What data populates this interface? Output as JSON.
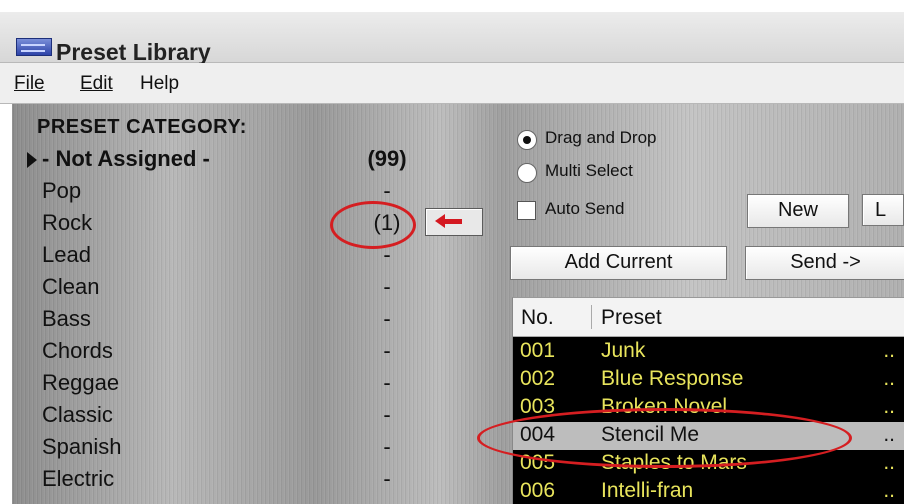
{
  "window": {
    "title": "Preset Library"
  },
  "menu": {
    "file": "File",
    "edit": "Edit",
    "help": "Help"
  },
  "category_panel": {
    "title": "PRESET CATEGORY:",
    "items": [
      {
        "label": "- Not Assigned -",
        "count": "(99)"
      },
      {
        "label": "Pop",
        "count": "-"
      },
      {
        "label": "Rock",
        "count": "(1)"
      },
      {
        "label": "Lead",
        "count": "-"
      },
      {
        "label": "Clean",
        "count": "-"
      },
      {
        "label": "Bass",
        "count": "-"
      },
      {
        "label": "Chords",
        "count": "-"
      },
      {
        "label": "Reggae",
        "count": "-"
      },
      {
        "label": "Classic",
        "count": "-"
      },
      {
        "label": "Spanish",
        "count": "-"
      },
      {
        "label": "Electric",
        "count": "-"
      }
    ]
  },
  "options": {
    "drag_and_drop": "Drag and Drop",
    "multi_select": "Multi Select",
    "auto_send": "Auto Send"
  },
  "buttons": {
    "new": "New",
    "next_cut": "L",
    "add_current": "Add Current",
    "send": "Send ->"
  },
  "preset_list": {
    "headers": {
      "number": "No.",
      "preset": "Preset"
    },
    "rows": [
      {
        "no": "001",
        "name": "Junk",
        "more": ".."
      },
      {
        "no": "002",
        "name": "Blue Response",
        "more": ".."
      },
      {
        "no": "003",
        "name": "Broken Novel",
        "more": ".."
      },
      {
        "no": "004",
        "name": "Stencil Me",
        "more": ".."
      },
      {
        "no": "005",
        "name": "Staples to Mars",
        "more": ".."
      },
      {
        "no": "006",
        "name": "Intelli-fran",
        "more": ".."
      }
    ]
  },
  "icons": {
    "app": "preset-library-app-icon",
    "selection_marker": "triangle-right-icon",
    "assign_arrow": "left-arrow-icon"
  },
  "colors": {
    "highlight_oval": "#d51e21",
    "list_text": "#e8e45c",
    "selected_row": "#bdbdbd"
  }
}
